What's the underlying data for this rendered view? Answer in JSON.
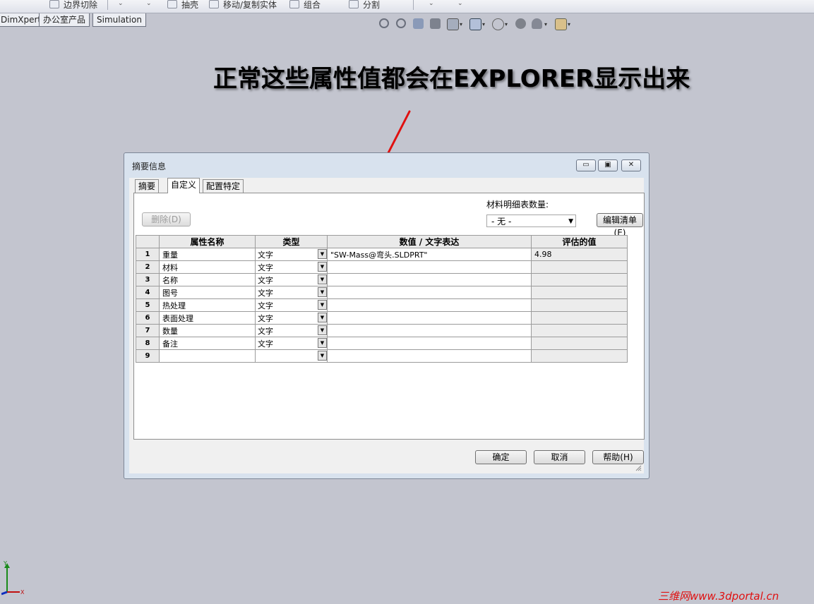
{
  "toolbar": {
    "items": [
      "边界切除",
      "抽壳",
      "移动/复制实体",
      "组合",
      "分割"
    ]
  },
  "tabs": [
    "DimXpert",
    "办公室产品",
    "Simulation"
  ],
  "annotation": "正常这些属性值都会在EXPLORER显示出来",
  "dialog": {
    "title": "摘要信息",
    "tabs": [
      "摘要",
      "自定义",
      "配置特定"
    ],
    "delete_label": "删除(D)",
    "bom_label": "材料明细表数量:",
    "bom_value": "- 无 -",
    "edit_list_label": "编辑清单(E)",
    "columns": [
      "属性名称",
      "类型",
      "数值 / 文字表达",
      "评估的值"
    ],
    "rows": [
      {
        "num": "1",
        "name": "重量",
        "type": "文字",
        "expr": "\"SW-Mass@弯头.SLDPRT\"",
        "eval": "4.98"
      },
      {
        "num": "2",
        "name": "材料",
        "type": "文字",
        "expr": "",
        "eval": ""
      },
      {
        "num": "3",
        "name": "名称",
        "type": "文字",
        "expr": "",
        "eval": ""
      },
      {
        "num": "4",
        "name": "图号",
        "type": "文字",
        "expr": "",
        "eval": ""
      },
      {
        "num": "5",
        "name": "热处理",
        "type": "文字",
        "expr": "",
        "eval": ""
      },
      {
        "num": "6",
        "name": "表面处理",
        "type": "文字",
        "expr": "",
        "eval": ""
      },
      {
        "num": "7",
        "name": "数量",
        "type": "文字",
        "expr": "",
        "eval": ""
      },
      {
        "num": "8",
        "name": "备注",
        "type": "文字",
        "expr": "",
        "eval": ""
      },
      {
        "num": "9",
        "name": "",
        "type": "",
        "expr": "",
        "eval": ""
      }
    ],
    "ok_label": "确定",
    "cancel_label": "取消",
    "help_label": "帮助(H)"
  },
  "axis": {
    "y": "Y",
    "x": "X"
  },
  "watermark": "三维网www.3dportal.cn",
  "colors": {
    "arrow": "#e01010",
    "background": "#c3c5cf",
    "dialog_frame": "#d8e2ee"
  }
}
